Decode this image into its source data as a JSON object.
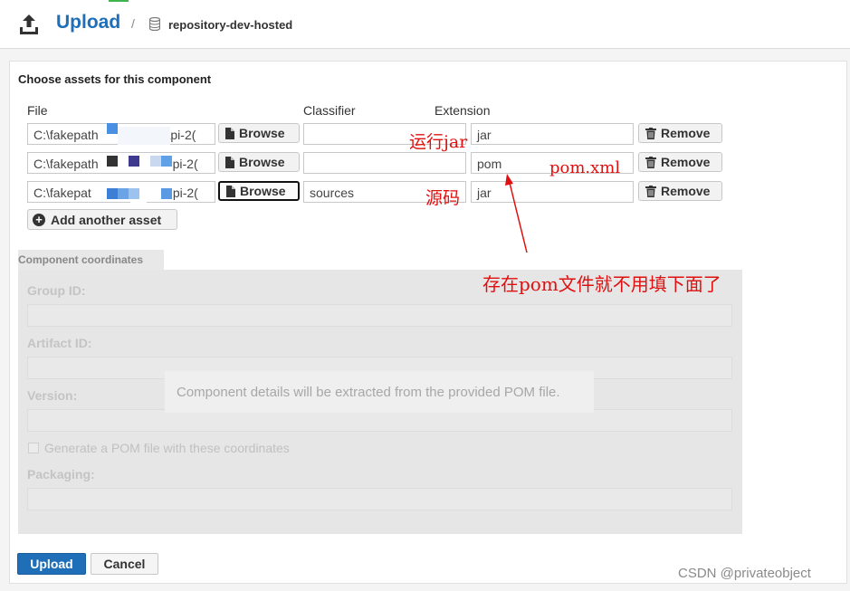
{
  "header": {
    "title": "Upload",
    "separator": "/",
    "repository": "repository-dev-hosted"
  },
  "form": {
    "section_heading": "Choose assets for this component",
    "columns": {
      "file": "File",
      "classifier": "Classifier",
      "extension": "Extension"
    },
    "rows": [
      {
        "file_prefix": "C:\\fakepath",
        "file_suffix": "api-2(",
        "browse": "Browse",
        "classifier": "",
        "extension": "jar",
        "remove": "Remove"
      },
      {
        "file_prefix": "C:\\fakepath",
        "file_suffix": "pi-2(",
        "browse": "Browse",
        "classifier": "",
        "extension": "pom",
        "remove": "Remove"
      },
      {
        "file_prefix": "C:\\fakepat",
        "file_suffix": "pi-2(",
        "browse": "Browse",
        "classifier": "sources",
        "extension": "jar",
        "remove": "Remove"
      }
    ],
    "add_asset": "Add another asset"
  },
  "coordinates": {
    "tab": "Component coordinates",
    "group_id": "Group ID:",
    "artifact_id": "Artifact ID:",
    "version": "Version:",
    "generate_pom": "Generate a POM file with these coordinates",
    "packaging": "Packaging:",
    "overlay_message": "Component details will be extracted from the provided POM file."
  },
  "footer": {
    "upload": "Upload",
    "cancel": "Cancel"
  },
  "annotations": {
    "run_jar": "运行jar",
    "source": "源码",
    "pom_xml": "pom.xml",
    "note": "存在pom文件就不用填下面了"
  },
  "watermark": "CSDN @privateobject",
  "colors": {
    "accent": "#1f6fb8",
    "annotation": "#e01010"
  }
}
